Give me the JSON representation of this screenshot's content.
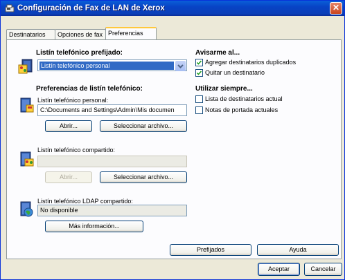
{
  "window": {
    "title": "Configuración de Fax de LAN de Xerox",
    "close_glyph": "✕"
  },
  "tabs": [
    {
      "label": "Destinatarios del fax"
    },
    {
      "label": "Opciones de fax"
    },
    {
      "label": "Preferencias"
    }
  ],
  "left": {
    "default_heading": "Listín telefónico prefijado:",
    "default_select_value": "Listín telefónico personal",
    "prefs_heading": "Preferencias de listín telefónico:",
    "personal_label": "Listín telefónico personal:",
    "personal_path": "C:\\Documents and Settings\\Admin\\Mis documen",
    "open_button": "Abrir...",
    "select_file_button": "Seleccionar archivo...",
    "shared_label": "Listín telefónico compartido:",
    "shared_path": "",
    "shared_open_button": "Abrir...",
    "shared_select_file_button": "Seleccionar archivo...",
    "ldap_label": "Listín telefónico LDAP compartido:",
    "ldap_value": "No disponible",
    "more_info_button": "Más información..."
  },
  "right": {
    "notify_heading": "Avisarme al...",
    "notify_options": [
      {
        "label": "Agregar destinatarios duplicados",
        "checked": true
      },
      {
        "label": "Quitar un destinatario",
        "checked": true
      }
    ],
    "always_heading": "Utilizar siempre...",
    "always_options": [
      {
        "label": "Lista de destinatarios actual",
        "checked": false
      },
      {
        "label": "Notas de portada actuales",
        "checked": false
      }
    ]
  },
  "panel_buttons": {
    "defaults": "Prefijados",
    "help": "Ayuda"
  },
  "dialog_buttons": {
    "ok": "Aceptar",
    "cancel": "Cancelar"
  }
}
